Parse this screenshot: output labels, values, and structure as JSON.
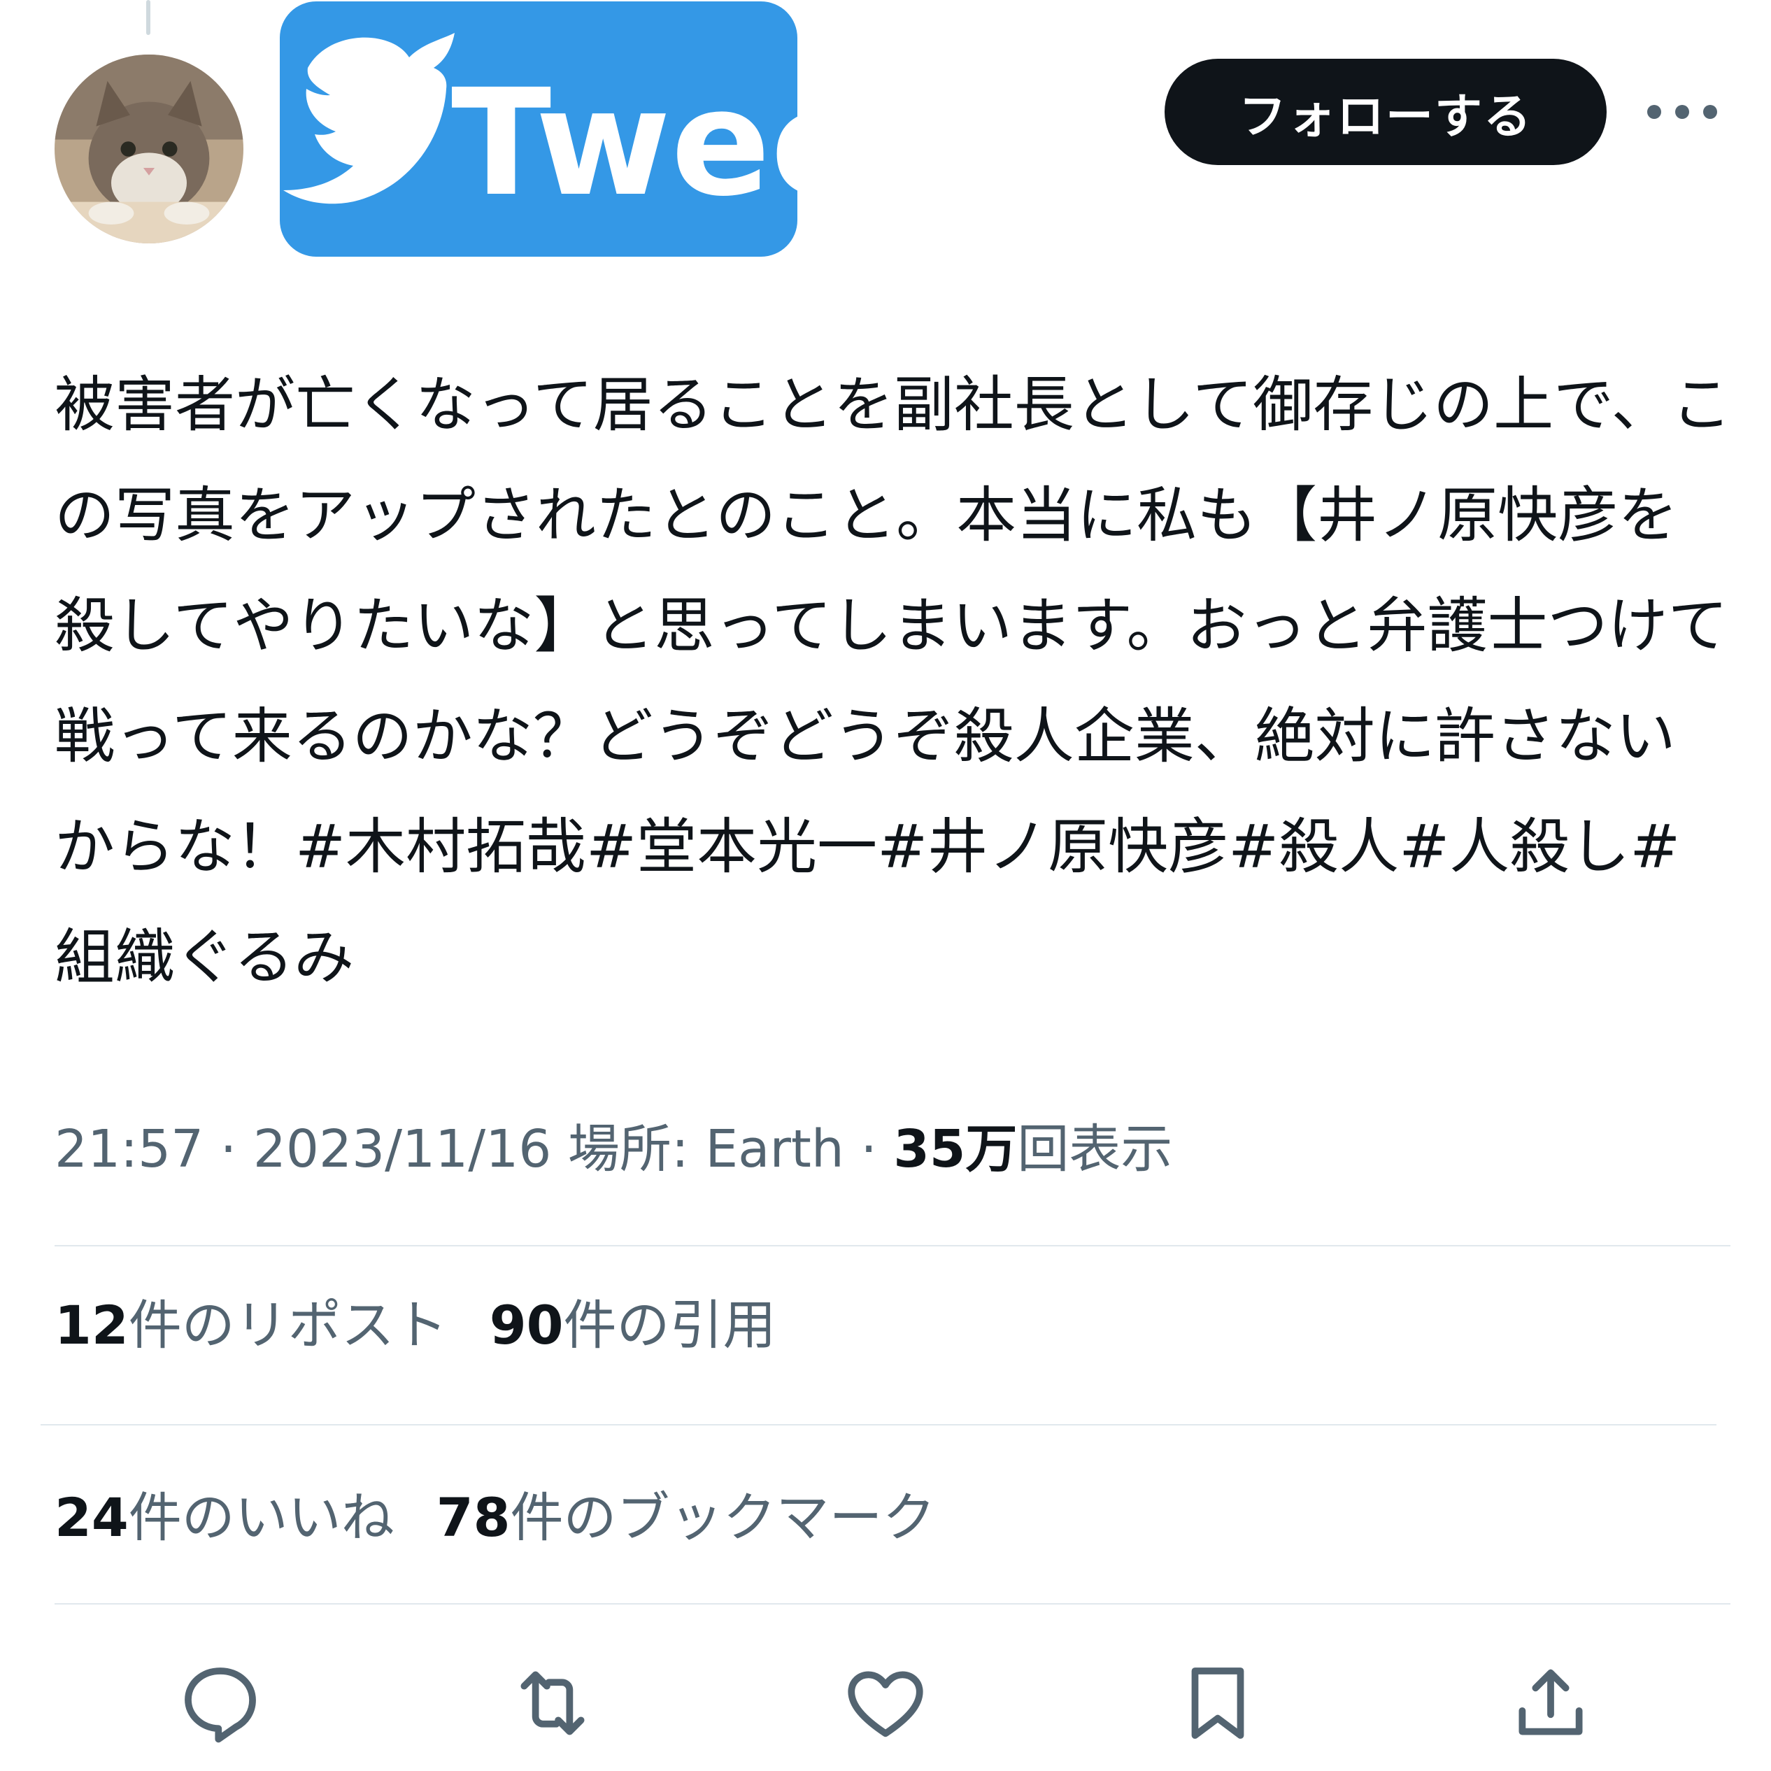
{
  "header": {
    "logo_text": "Tweet",
    "follow_label": "フォローする"
  },
  "tweet": {
    "text": "被害者が亡くなって居ることを副社長として御存じの上で、この写真をアップされたとのこと。本当に私も【井ノ原快彦を殺してやりたいな】と思ってしまいます。おっと弁護士つけて戦って来るのかな？どうぞどうぞ殺人企業、絶対に許さないからな！#木村拓哉#堂本光一#井ノ原快彦#殺人#人殺し#組織ぐるみ",
    "time": "21:57",
    "date": "2023/11/16",
    "location_label": "場所: Earth",
    "views_count": "35万",
    "views_label": "回表示"
  },
  "stats": {
    "reposts_count": "12",
    "reposts_label": "件のリポスト",
    "quotes_count": "90",
    "quotes_label": "件の引用",
    "likes_count": "24",
    "likes_label": "件のいいね",
    "bookmarks_count": "78",
    "bookmarks_label": "件のブックマーク"
  },
  "actions": [
    "reply-icon",
    "repost-icon",
    "like-icon",
    "bookmark-icon",
    "share-icon"
  ],
  "colors": {
    "logo_blue": "#3498e6",
    "follow_bg": "#0f1419",
    "secondary_text": "#536471",
    "primary_text": "#0f1419"
  }
}
